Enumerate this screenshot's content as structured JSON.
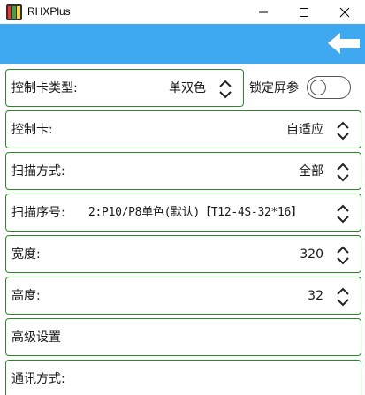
{
  "window": {
    "title": "RHXPlus"
  },
  "rows": {
    "card_type": {
      "label": "控制卡类型:",
      "value": "单双色"
    },
    "lock_params": {
      "label": "锁定屏参",
      "on": false
    },
    "card": {
      "label": "控制卡:",
      "value": "自适应"
    },
    "scan_mode": {
      "label": "扫描方式:",
      "value": "全部"
    },
    "scan_seq": {
      "label": "扫描序号:",
      "value": "2:P10/P8单色(默认)【T12-4S-32*16】"
    },
    "width": {
      "label": "宽度:",
      "value": "320"
    },
    "height": {
      "label": "高度:",
      "value": "32"
    },
    "advanced": {
      "label": "高级设置"
    },
    "comm_mode": {
      "label": "通讯方式:"
    }
  },
  "icons": {
    "app": "rhxplus-app-icon",
    "minimize": "minimize-icon",
    "maximize": "maximize-icon",
    "close": "close-icon",
    "back": "arrow-left-icon",
    "updown": "updown-chevron-icon"
  },
  "colors": {
    "toolbar": "#3ea8f0",
    "row_border": "#2a8a2a"
  }
}
